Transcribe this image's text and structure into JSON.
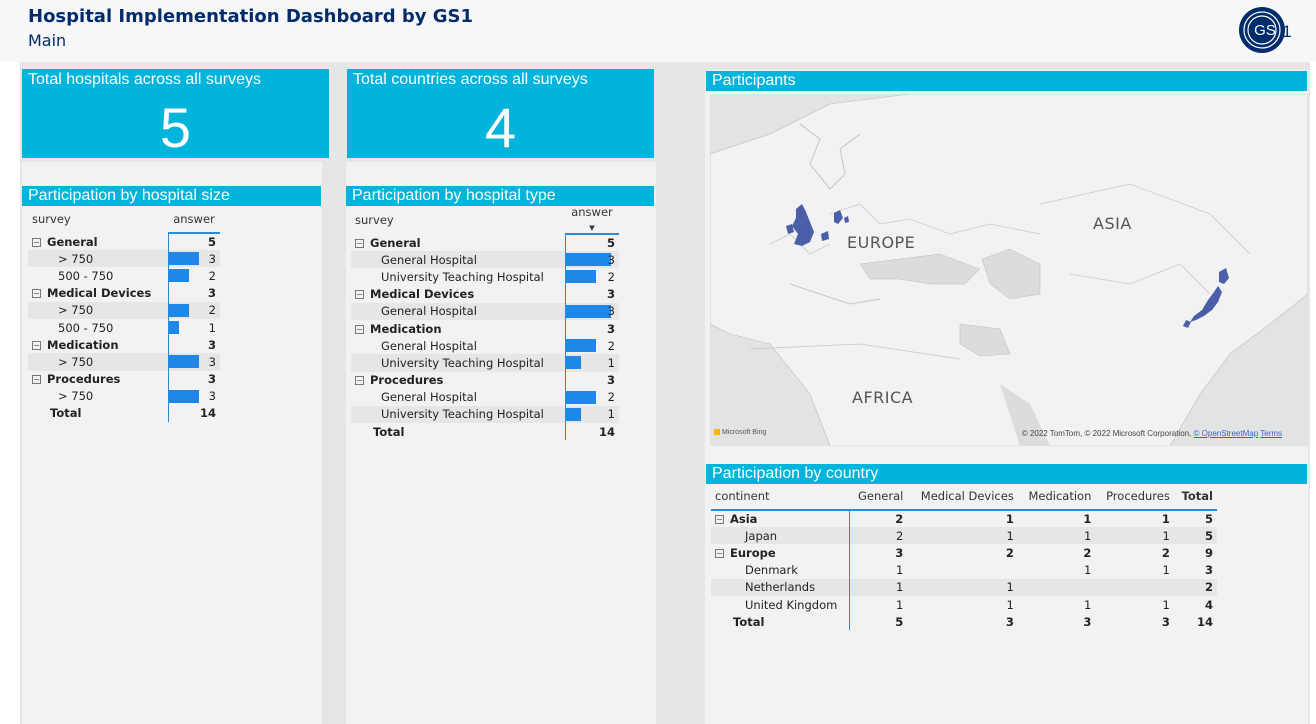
{
  "header": {
    "title": "Hospital Implementation Dashboard by GS1",
    "subtitle": "Main",
    "logo_text": "GS1"
  },
  "kpis": [
    {
      "label": "Total hospitals across all surveys",
      "value": "5"
    },
    {
      "label": "Total countries across all surveys",
      "value": "4"
    }
  ],
  "size_table": {
    "title": "Participation by hospital size",
    "col_survey": "survey",
    "col_answer": "answer",
    "max": 3,
    "groups": [
      {
        "label": "General",
        "total": "5",
        "rows": [
          {
            "label": "> 750",
            "value": 3
          },
          {
            "label": "500 - 750",
            "value": 2
          }
        ]
      },
      {
        "label": "Medical Devices",
        "total": "3",
        "rows": [
          {
            "label": "> 750",
            "value": 2
          },
          {
            "label": "500 - 750",
            "value": 1
          }
        ]
      },
      {
        "label": "Medication",
        "total": "3",
        "rows": [
          {
            "label": "> 750",
            "value": 3
          }
        ]
      },
      {
        "label": "Procedures",
        "total": "3",
        "rows": [
          {
            "label": "> 750",
            "value": 3
          }
        ]
      }
    ],
    "total_label": "Total",
    "total_value": "14"
  },
  "type_table": {
    "title": "Participation by hospital type",
    "col_survey": "survey",
    "col_answer": "answer",
    "max": 3,
    "groups": [
      {
        "label": "General",
        "total": "5",
        "rows": [
          {
            "label": "General Hospital",
            "value": 3
          },
          {
            "label": "University Teaching Hospital",
            "value": 2
          }
        ]
      },
      {
        "label": "Medical Devices",
        "total": "3",
        "rows": [
          {
            "label": "General Hospital",
            "value": 3
          }
        ]
      },
      {
        "label": "Medication",
        "total": "3",
        "rows": [
          {
            "label": "General Hospital",
            "value": 2
          },
          {
            "label": "University Teaching Hospital",
            "value": 1
          }
        ]
      },
      {
        "label": "Procedures",
        "total": "3",
        "rows": [
          {
            "label": "General Hospital",
            "value": 2
          },
          {
            "label": "University Teaching Hospital",
            "value": 1
          }
        ]
      }
    ],
    "total_label": "Total",
    "total_value": "14"
  },
  "map": {
    "title": "Participants",
    "labels": {
      "europe": "EUROPE",
      "asia": "ASIA",
      "africa": "AFRICA"
    },
    "copyright": "© 2022 TomTom, © 2022 Microsoft Corporation,",
    "osm_link": "© OpenStreetMap",
    "terms_link": "Terms",
    "bing": "Microsoft Bing",
    "highlight_color": "#4a5fa8",
    "highlighted_countries": [
      "United Kingdom",
      "Netherlands",
      "Denmark",
      "Japan"
    ]
  },
  "country_table": {
    "title": "Participation by country",
    "columns": [
      "continent",
      "General",
      "Medical Devices",
      "Medication",
      "Procedures",
      "Total"
    ],
    "rows": [
      {
        "kind": "group",
        "cells": [
          "Asia",
          "2",
          "1",
          "1",
          "1",
          "5"
        ]
      },
      {
        "kind": "child",
        "cells": [
          "Japan",
          "2",
          "1",
          "1",
          "1",
          "5"
        ]
      },
      {
        "kind": "group",
        "cells": [
          "Europe",
          "3",
          "2",
          "2",
          "2",
          "9"
        ]
      },
      {
        "kind": "child",
        "cells": [
          "Denmark",
          "1",
          "",
          "1",
          "1",
          "3"
        ]
      },
      {
        "kind": "child",
        "cells": [
          "Netherlands",
          "1",
          "1",
          "",
          "",
          "2"
        ]
      },
      {
        "kind": "child",
        "cells": [
          "United Kingdom",
          "1",
          "1",
          "1",
          "1",
          "4"
        ]
      },
      {
        "kind": "total",
        "cells": [
          "Total",
          "5",
          "3",
          "3",
          "3",
          "14"
        ]
      }
    ]
  },
  "colors": {
    "accent": "#00b4dc",
    "bar": "#1f87e8",
    "title_text": "#002c6c"
  }
}
